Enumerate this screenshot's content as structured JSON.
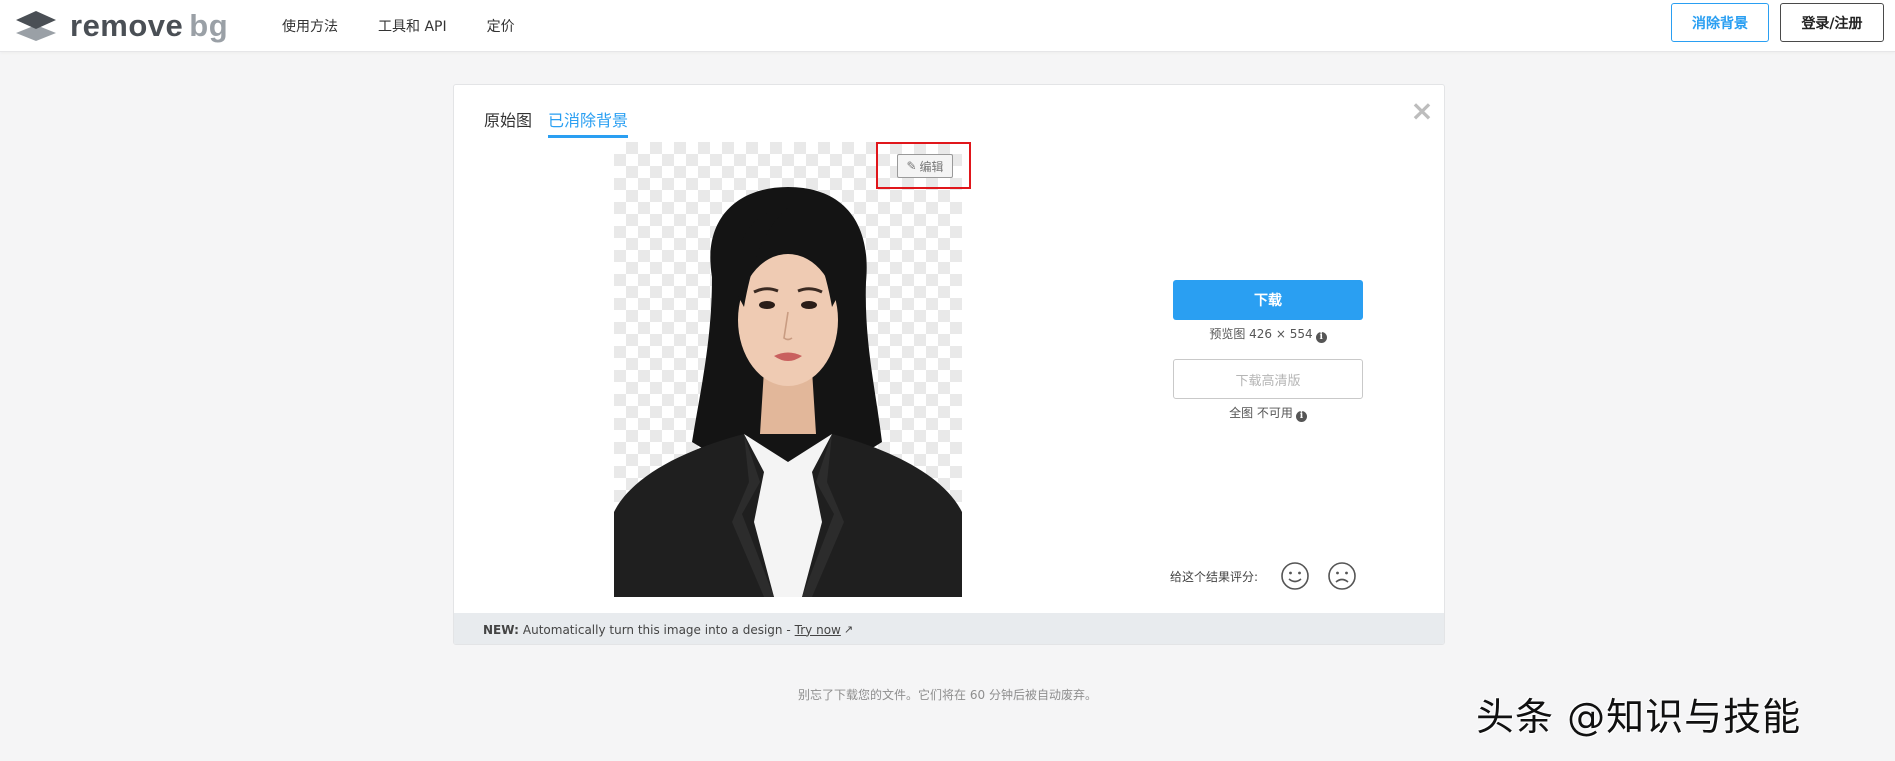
{
  "header": {
    "logo_text": "remove",
    "logo_text_bg": "bg",
    "nav": [
      "使用方法",
      "工具和 API",
      "定价"
    ],
    "remove_bg_button": "消除背景",
    "login_button": "登录/注册"
  },
  "card": {
    "tabs": [
      "原始图",
      "已消除背景"
    ],
    "active_tab": "已消除背景",
    "edit_button": "编辑",
    "download_button": "下载",
    "preview_note": "预览图 426 × 554",
    "hd_button": "下载高清版",
    "full_note": "全图 不可用",
    "rating_label": "给这个结果评分:",
    "footer": {
      "new_label": "NEW:",
      "text": "Automatically turn this image into a design -",
      "link": "Try now"
    }
  },
  "bottom_note": "别忘了下载您的文件。它们将在 60 分钟后被自动废弃。",
  "watermark": "头条 @知识与技能",
  "colors": {
    "accent": "#2a9ff2",
    "highlight": "#e0161b",
    "footer_bg": "#e8ebee"
  },
  "icons": [
    "logo-layers-icon",
    "close-icon",
    "pencil-icon",
    "info-icon",
    "smiley-icon",
    "frown-icon",
    "external-link-icon"
  ]
}
